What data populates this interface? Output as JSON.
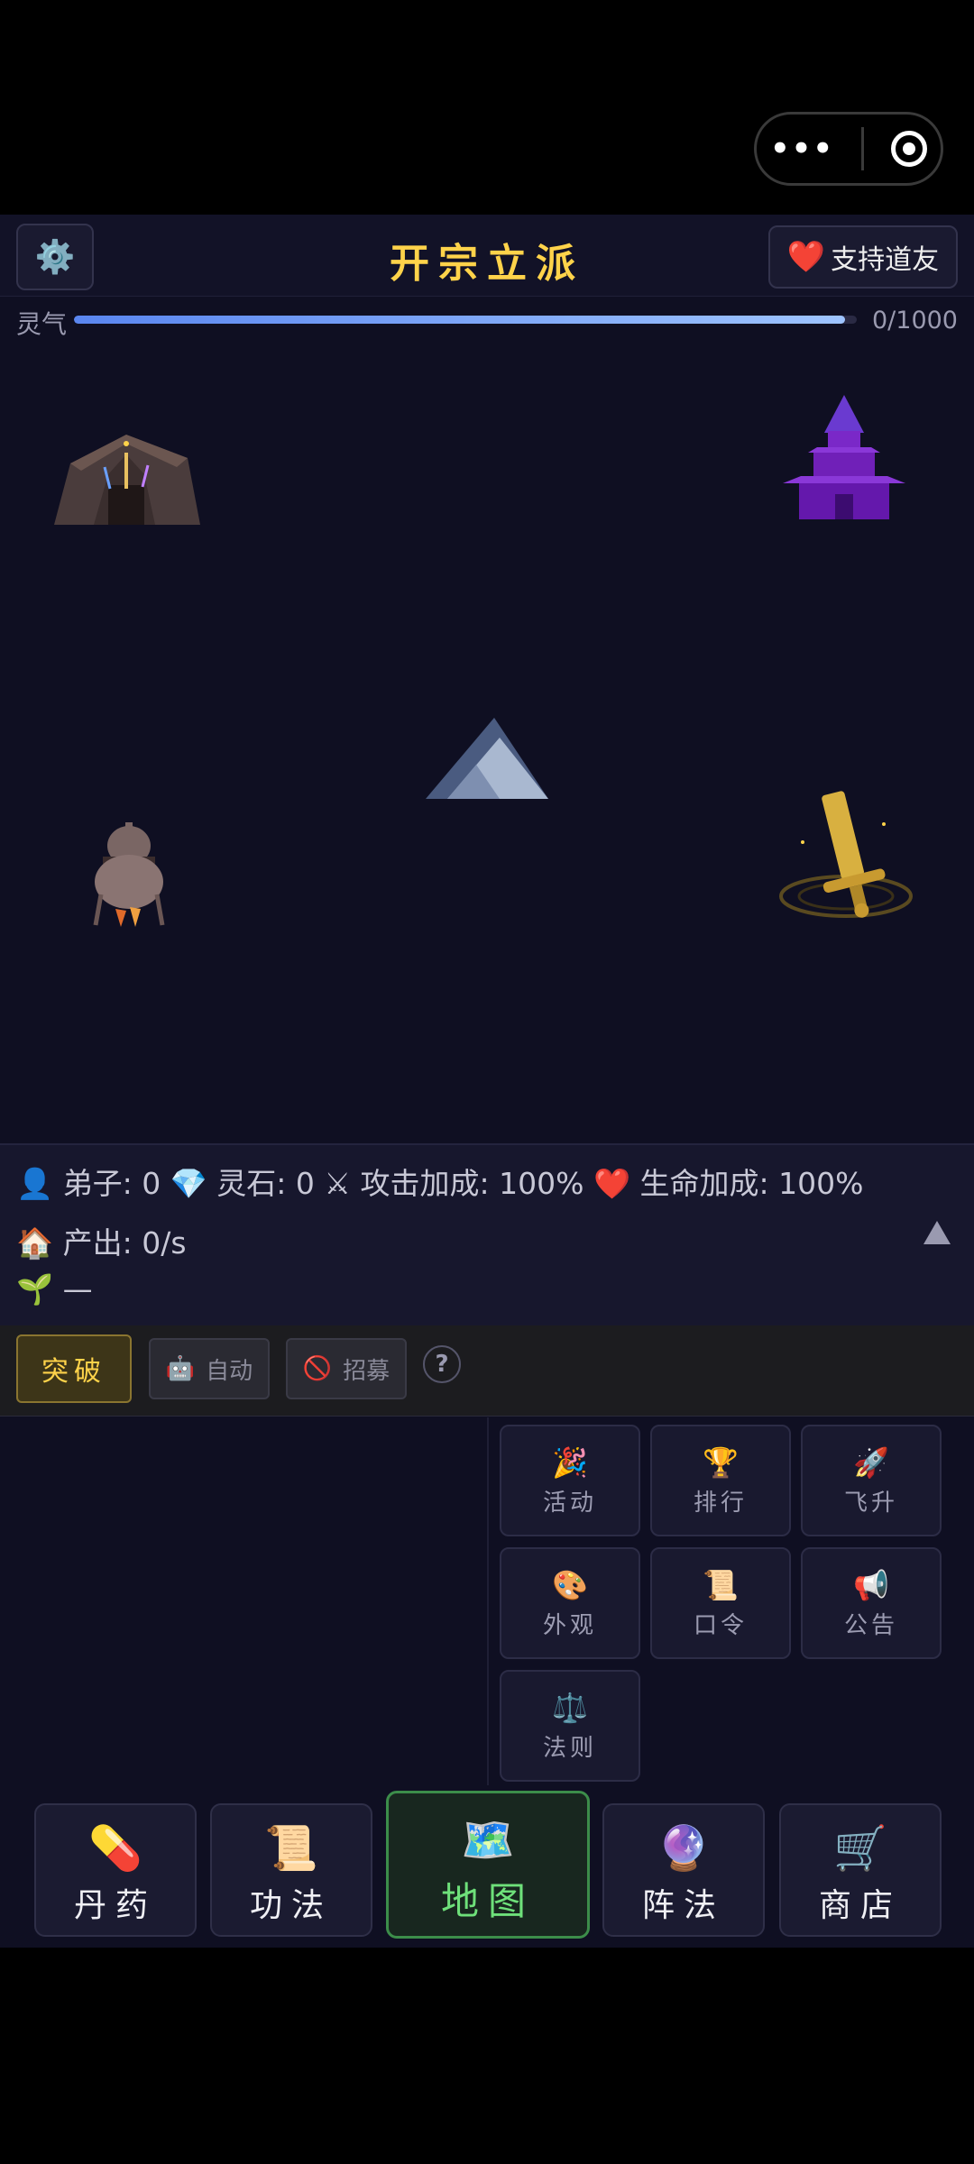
{
  "header": {
    "title": "开宗立派",
    "settings_icon": "⚙️",
    "support_heart": "❤️",
    "support_label": "支持道友"
  },
  "qi": {
    "label": "灵气",
    "value_text": "0/1000",
    "progress": 0.985
  },
  "stats": {
    "disciples_icon": "👤",
    "disciples": "弟子: 0",
    "stones_icon": "💎",
    "stones": "灵石: 0",
    "attack_icon": "⚔",
    "attack": "攻击加成: 100%",
    "life_icon": "❤️",
    "life": "生命加成: 100%",
    "output_icon": "🏠",
    "output": "产出: 0/s",
    "sprout_icon": "🌱",
    "sprout_text": "—"
  },
  "actions": {
    "breakthrough": "突破",
    "auto_icon": "🤖",
    "auto": "自动",
    "recruit_icon": "🚫",
    "recruit": "招募",
    "help": "?"
  },
  "grid": [
    {
      "icon": "🎉",
      "label": "活动"
    },
    {
      "icon": "🏆",
      "label": "排行"
    },
    {
      "icon": "🚀",
      "label": "飞升"
    },
    {
      "icon": "🎨",
      "label": "外观"
    },
    {
      "icon": "📜",
      "label": "口令"
    },
    {
      "icon": "📢",
      "label": "公告"
    },
    {
      "icon": "⚖️",
      "label": "法则"
    }
  ],
  "nav": [
    {
      "icon": "💊",
      "label": "丹药"
    },
    {
      "icon": "📜",
      "label": "功法"
    },
    {
      "icon": "🗺️",
      "label": "地图"
    },
    {
      "icon": "🔮",
      "label": "阵法"
    },
    {
      "icon": "🛒",
      "label": "商店"
    }
  ],
  "capsule": {
    "more_label": "•••"
  }
}
